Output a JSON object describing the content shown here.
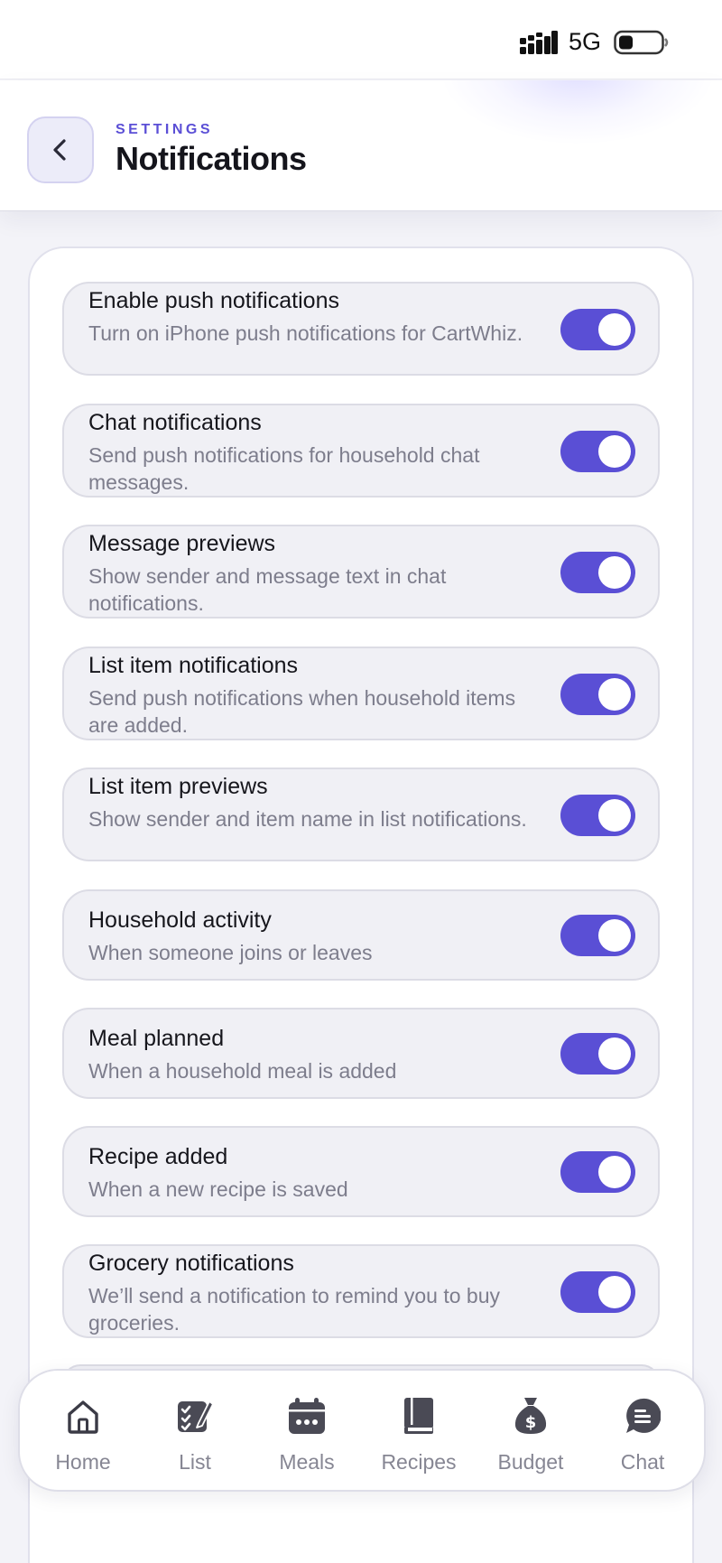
{
  "status_bar": {
    "network": "5G"
  },
  "header": {
    "eyebrow": "SETTINGS",
    "title": "Notifications"
  },
  "settings": [
    {
      "title": "Enable push notifications",
      "description": "Turn on iPhone push notifications for CartWhiz.",
      "enabled": true
    },
    {
      "title": "Chat notifications",
      "description": "Send push notifications for household chat messages.",
      "enabled": true
    },
    {
      "title": "Message previews",
      "description": "Show sender and message text in chat notifications.",
      "enabled": true
    },
    {
      "title": "List item notifications",
      "description": "Send push notifications when household items are added.",
      "enabled": true
    },
    {
      "title": "List item previews",
      "description": "Show sender and item name in list notifications.",
      "enabled": true
    },
    {
      "title": "Household activity",
      "description": "When someone joins or leaves",
      "enabled": true
    },
    {
      "title": "Meal planned",
      "description": "When a household meal is added",
      "enabled": true
    },
    {
      "title": "Recipe added",
      "description": "When a new recipe is saved",
      "enabled": true
    },
    {
      "title": "Grocery notifications",
      "description": "We’ll send a notification to remind you to buy groceries.",
      "enabled": true
    }
  ],
  "tabbar": {
    "items": [
      {
        "label": "Home",
        "icon": "home-icon"
      },
      {
        "label": "List",
        "icon": "checklist-edit-icon"
      },
      {
        "label": "Meals",
        "icon": "calendar-icon"
      },
      {
        "label": "Recipes",
        "icon": "book-icon"
      },
      {
        "label": "Budget",
        "icon": "money-bag-icon"
      },
      {
        "label": "Chat",
        "icon": "chat-bubble-icon"
      }
    ]
  },
  "colors": {
    "accent": "#5a4fd5",
    "eyebrow": "#5b4fd6",
    "tab_inactive": "#868693",
    "background": "#f3f3f8"
  }
}
